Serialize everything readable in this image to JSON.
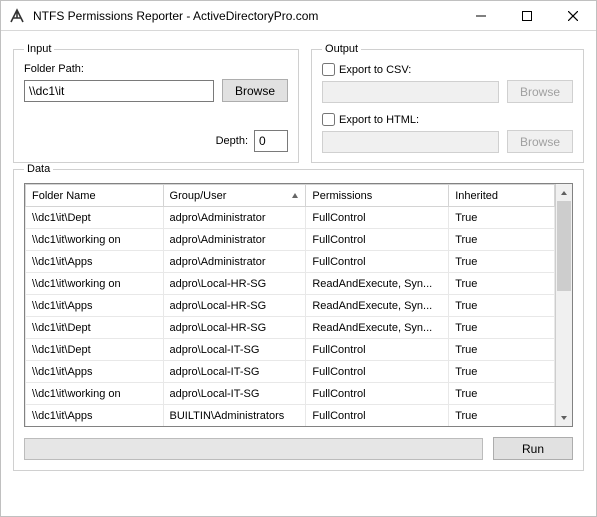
{
  "window": {
    "title": "NTFS Permissions Reporter - ActiveDirectoryPro.com"
  },
  "input": {
    "legend": "Input",
    "folder_label": "Folder Path:",
    "folder_value": "\\\\dc1\\it",
    "browse_label": "Browse",
    "depth_label": "Depth:",
    "depth_value": "0"
  },
  "output": {
    "legend": "Output",
    "csv_label": "Export to CSV:",
    "html_label": "Export to HTML:",
    "browse_label": "Browse",
    "csv_path": "",
    "html_path": ""
  },
  "data": {
    "legend": "Data",
    "columns": {
      "folder": "Folder Name",
      "group": "Group/User",
      "perm": "Permissions",
      "inh": "Inherited"
    },
    "rows": [
      {
        "folder": "\\\\dc1\\it\\Dept",
        "group": "adpro\\Administrator",
        "perm": "FullControl",
        "inh": "True"
      },
      {
        "folder": "\\\\dc1\\it\\working on",
        "group": "adpro\\Administrator",
        "perm": "FullControl",
        "inh": "True"
      },
      {
        "folder": "\\\\dc1\\it\\Apps",
        "group": "adpro\\Administrator",
        "perm": "FullControl",
        "inh": "True"
      },
      {
        "folder": "\\\\dc1\\it\\working on",
        "group": "adpro\\Local-HR-SG",
        "perm": "ReadAndExecute, Syn...",
        "inh": "True"
      },
      {
        "folder": "\\\\dc1\\it\\Apps",
        "group": "adpro\\Local-HR-SG",
        "perm": "ReadAndExecute, Syn...",
        "inh": "True"
      },
      {
        "folder": "\\\\dc1\\it\\Dept",
        "group": "adpro\\Local-HR-SG",
        "perm": "ReadAndExecute, Syn...",
        "inh": "True"
      },
      {
        "folder": "\\\\dc1\\it\\Dept",
        "group": "adpro\\Local-IT-SG",
        "perm": "FullControl",
        "inh": "True"
      },
      {
        "folder": "\\\\dc1\\it\\Apps",
        "group": "adpro\\Local-IT-SG",
        "perm": "FullControl",
        "inh": "True"
      },
      {
        "folder": "\\\\dc1\\it\\working on",
        "group": "adpro\\Local-IT-SG",
        "perm": "FullControl",
        "inh": "True"
      },
      {
        "folder": "\\\\dc1\\it\\Apps",
        "group": "BUILTIN\\Administrators",
        "perm": "FullControl",
        "inh": "True"
      }
    ],
    "run_label": "Run"
  }
}
